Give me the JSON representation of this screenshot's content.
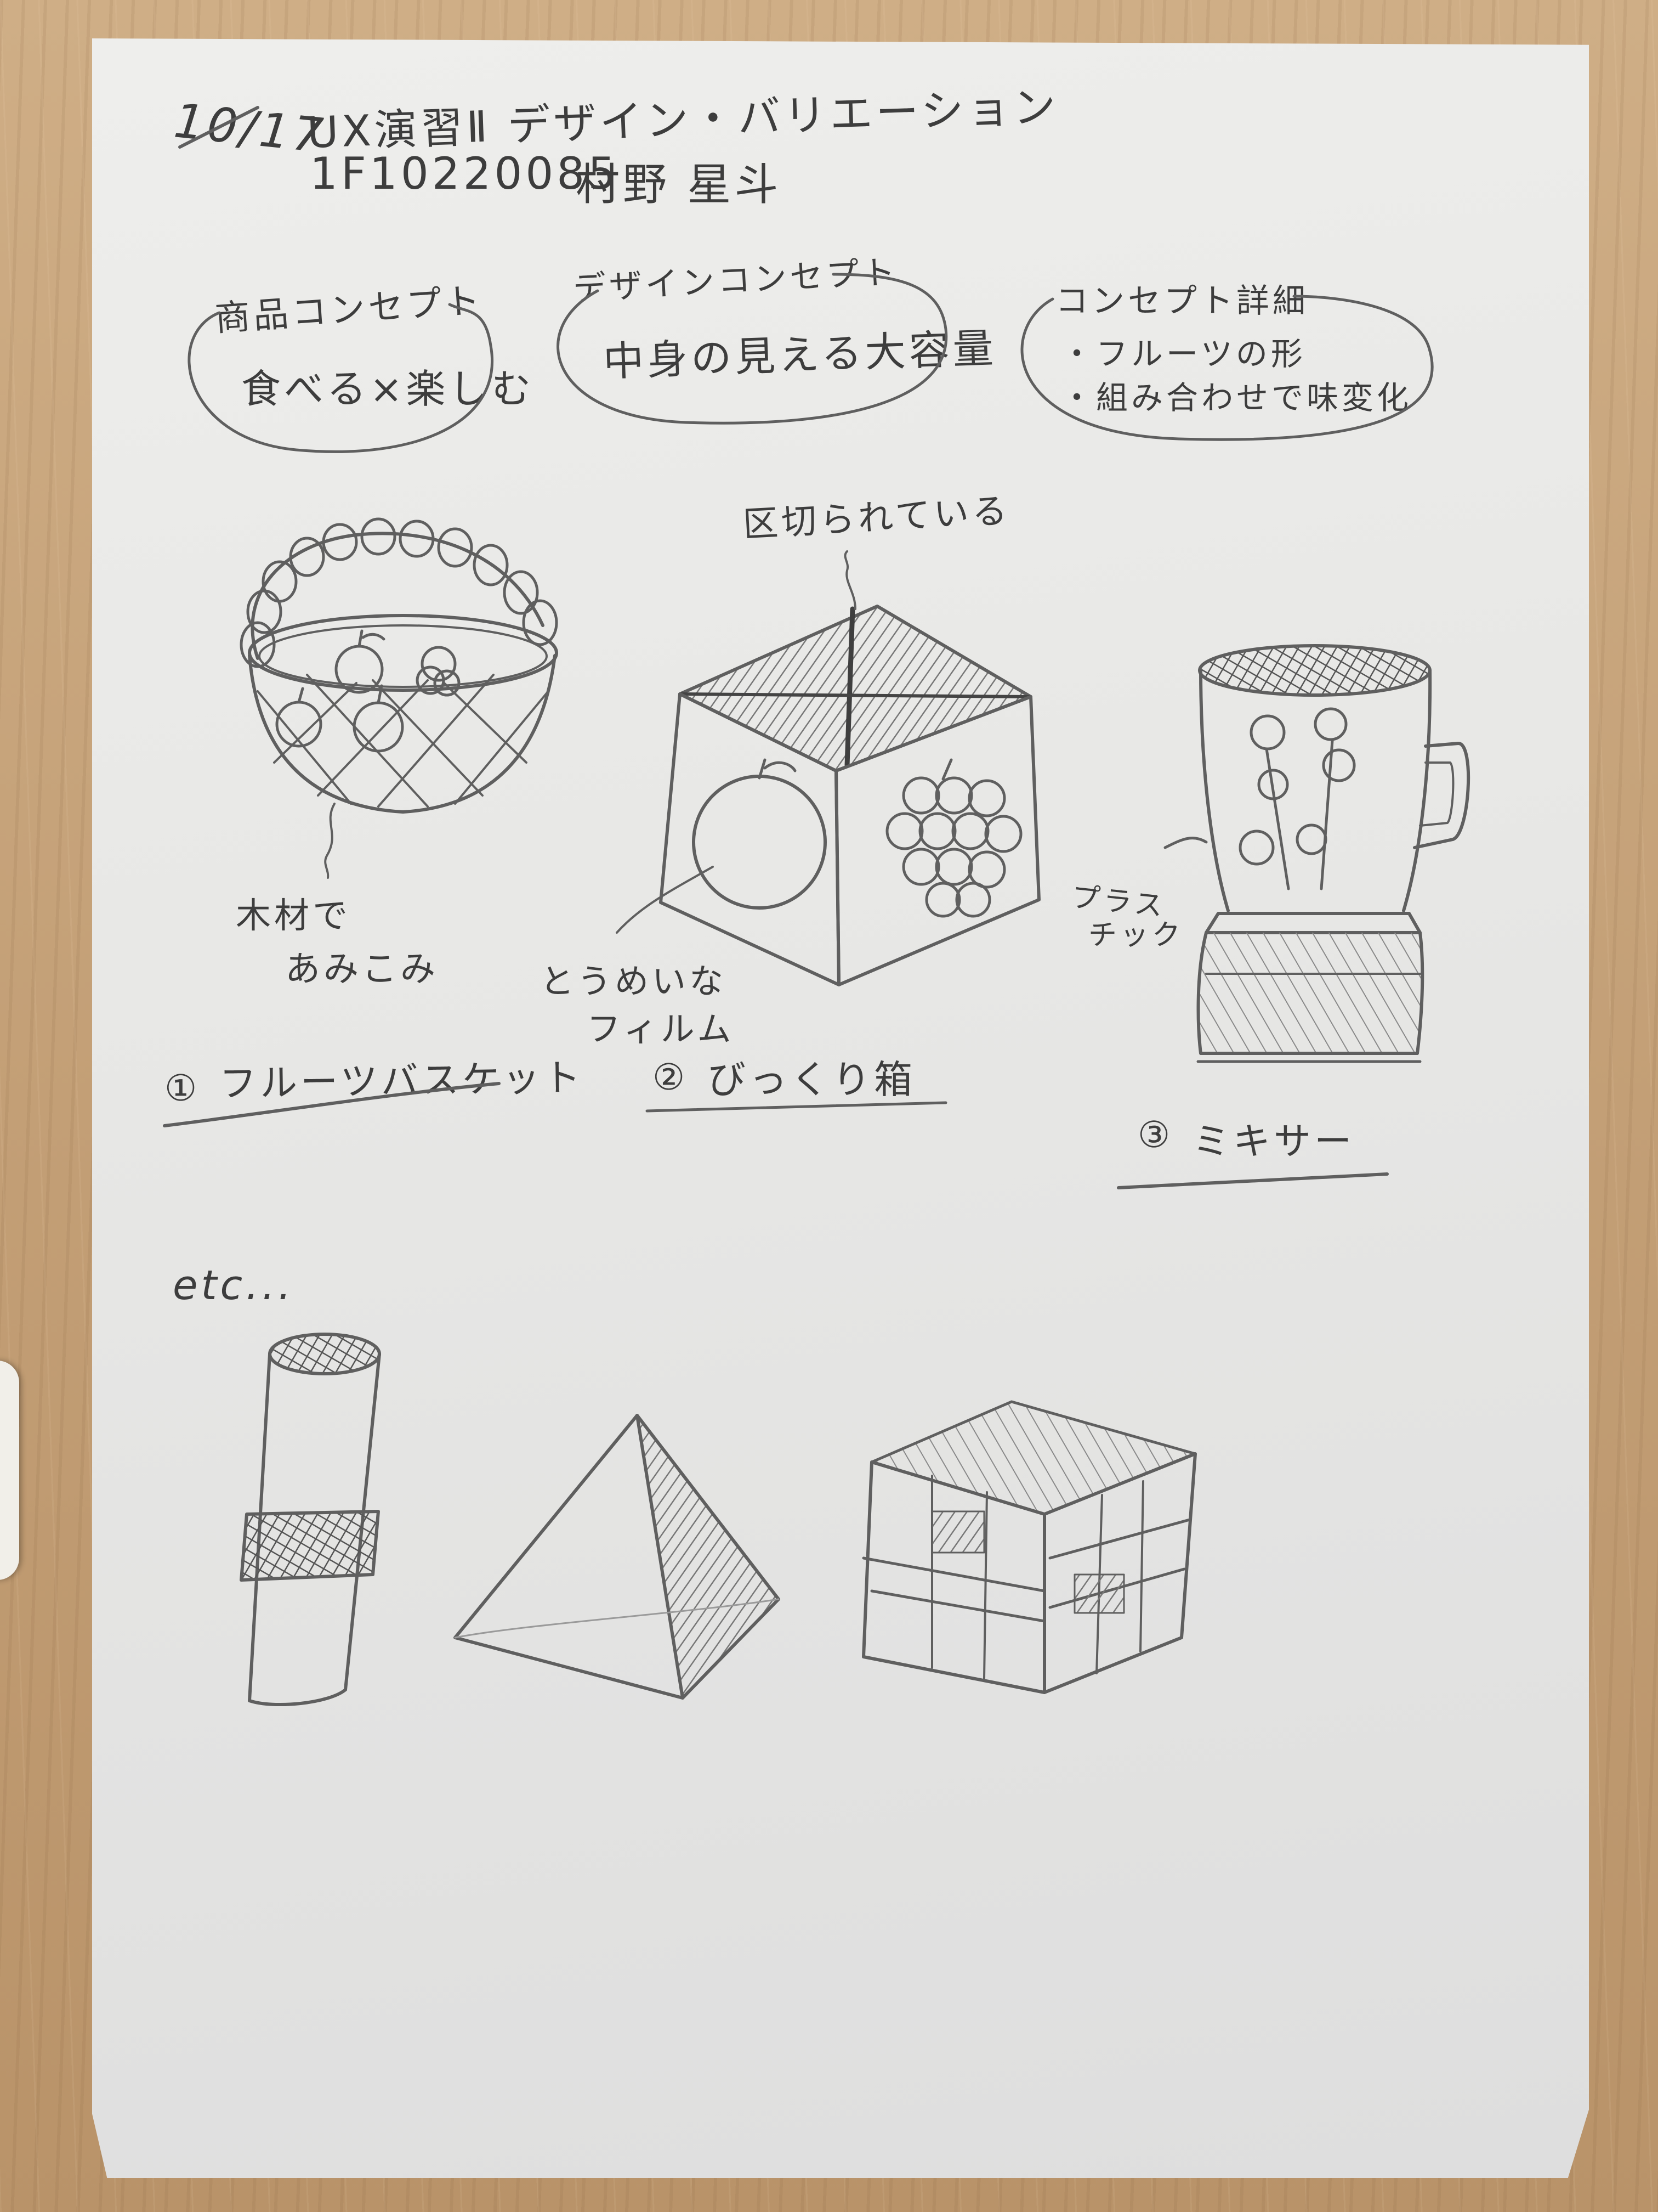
{
  "header": {
    "date": "10/17",
    "course": "UX演習Ⅱ デザイン・バリエーション",
    "student_id": "1F10220085",
    "student_name": "村野 星斗"
  },
  "concepts": {
    "product_concept_label": "商品コンセプト",
    "product_concept_value": "食べる×楽しむ",
    "design_concept_label": "デザインコンセプト",
    "design_concept_value": "中身の見える大容量",
    "detail_label": "コンセプト詳細",
    "detail_items": [
      "・フルーツの形",
      "・組み合わせで味変化"
    ]
  },
  "sketches": {
    "basket": {
      "annotation": "木材であみこみ",
      "annotation_line1": "木材で",
      "annotation_line2": "あみこみ",
      "caption_number": "①",
      "caption": "フルーツバスケット"
    },
    "box": {
      "top_annotation": "区切られている",
      "film_annotation_line1": "とうめいな",
      "film_annotation_line2": "フィルム",
      "caption_number": "②",
      "caption": "びっくり箱"
    },
    "mixer": {
      "annotation_line1": "プラス",
      "annotation_line2": "チック",
      "caption_number": "③",
      "caption": "ミキサー"
    }
  },
  "etc_label": "etc..."
}
